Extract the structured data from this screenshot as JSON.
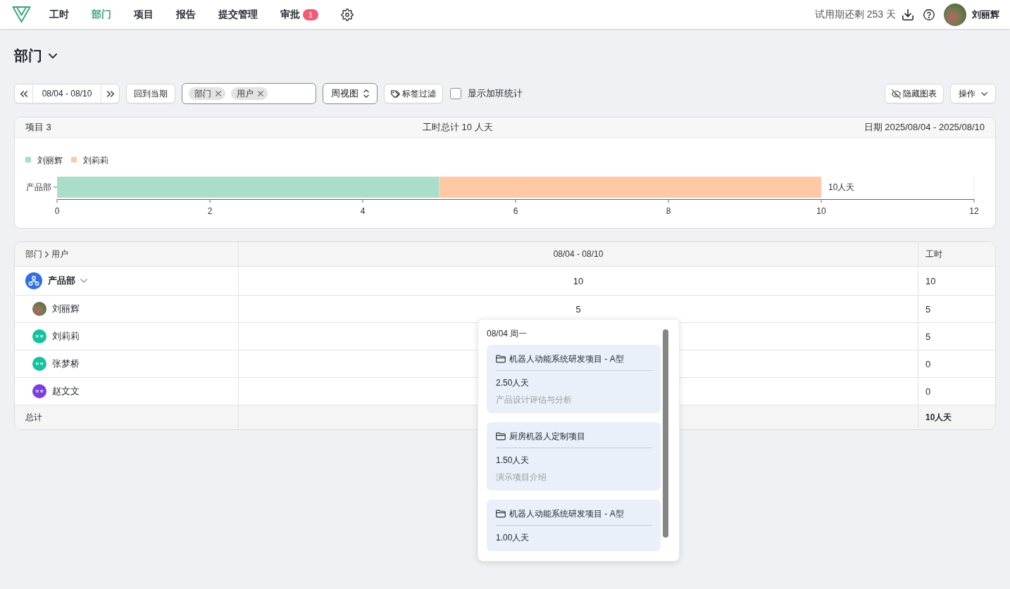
{
  "nav": {
    "items": [
      {
        "label": "工时",
        "selected": false
      },
      {
        "label": "部门",
        "selected": true
      },
      {
        "label": "项目",
        "selected": false
      },
      {
        "label": "报告",
        "selected": false
      },
      {
        "label": "提交管理",
        "selected": false
      },
      {
        "label": "审批",
        "selected": false,
        "badge": "1"
      }
    ],
    "trial": "试用期还剩 253 天",
    "user": "刘丽辉"
  },
  "page": {
    "title": "部门"
  },
  "toolbar": {
    "range": "08/04 - 08/10",
    "current_button": "回到当期",
    "group_tags": [
      "部门",
      "用户"
    ],
    "view": "周视图",
    "tag_filter": "标签过滤",
    "overtime": {
      "label": "显示加班统计",
      "checked": false
    },
    "hide_chart": "隐藏图表",
    "actions": "操作"
  },
  "summary": {
    "projects": "项目 3",
    "total": "工时总计 10 人天",
    "dates": "日期 2025/08/04 - 2025/08/10",
    "chart_data": {
      "type": "bar",
      "orientation": "horizontal",
      "stacked": true,
      "legend": "top-left",
      "categories": [
        "产品部"
      ],
      "series": [
        {
          "name": "刘丽辉",
          "color": "#a9dfc8",
          "values": [
            5
          ]
        },
        {
          "name": "刘莉莉",
          "color": "#ffc9a6",
          "values": [
            5
          ]
        }
      ],
      "xlim": [
        0,
        12
      ],
      "xticks": [
        0,
        2,
        4,
        6,
        8,
        10,
        12
      ],
      "value_labels": [
        "10人天"
      ]
    }
  },
  "table": {
    "header": {
      "path": [
        "部门",
        "用户"
      ],
      "period": "08/04 - 08/10",
      "total": "工时"
    },
    "rows": [
      {
        "kind": "department",
        "name": "产品部",
        "expanded": true,
        "period": "10",
        "total": "10",
        "children": [
          {
            "kind": "user",
            "name": "刘丽辉",
            "photo": true,
            "period": "5",
            "total": "5"
          },
          {
            "kind": "user",
            "name": "刘莉莉",
            "photo": false,
            "color": "#14c29f",
            "total": "5"
          },
          {
            "kind": "user",
            "name": "张梦桥",
            "photo": false,
            "color": "#14c29f",
            "total": "0"
          },
          {
            "kind": "user",
            "name": "赵文文",
            "photo": false,
            "color": "#7a3ee6",
            "total": "0"
          }
        ]
      }
    ],
    "footer": {
      "label": "总计",
      "total": "10人天"
    }
  },
  "popover": {
    "title": "08/04 周一",
    "entries": [
      {
        "project": "机器人动能系统研发项目 - A型",
        "amount": "2.50人天",
        "description": "产品设计评估与分析"
      },
      {
        "project": "厨房机器人定制项目",
        "amount": "1.50人天",
        "description": "演示项目介绍"
      },
      {
        "project": "机器人动能系统研发项目 - A型",
        "amount": "1.00人天"
      }
    ]
  }
}
